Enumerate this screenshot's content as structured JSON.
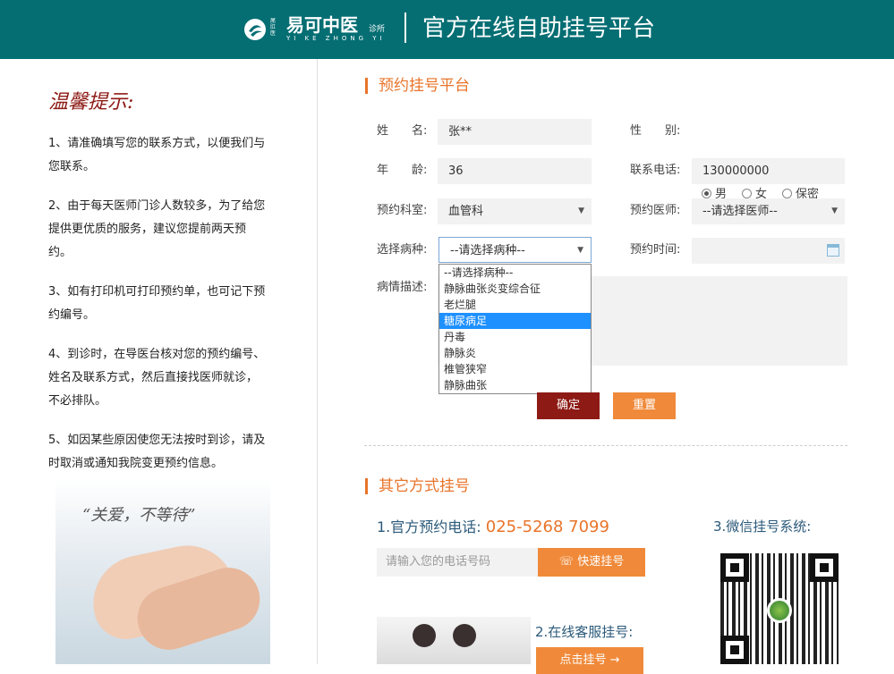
{
  "header": {
    "logo_small": "尾肛医",
    "logo_main": "易可中医",
    "logo_clinic": "诊所",
    "logo_pinyin": "YI KE ZHONG YI",
    "title": "官方在线自助挂号平台"
  },
  "tips": {
    "title": "温馨提示:",
    "items": [
      "1、请准确填写您的联系方式，以便我们与您联系。",
      "2、由于每天医师门诊人数较多，为了给您提供更优质的服务，建议您提前两天预约。",
      "3、如有打印机可打印预约单，也可记下预约编号。",
      "4、到诊时，在导医台核对您的预约编号、姓名及联系方式，然后直接找医师就诊，不必排队。",
      "5、如因某些原因使您无法按时到诊，请及时取消或通知我院变更预约信息。"
    ],
    "photo_quote": "“关爱，不等待”"
  },
  "form": {
    "section_title": "预约挂号平台",
    "name_label": "姓　　名:",
    "name_value": "张**",
    "gender_label": "性　　别:",
    "gender_options": [
      "男",
      "女",
      "保密"
    ],
    "gender_selected": "男",
    "age_label": "年　　龄:",
    "age_value": "36",
    "phone_label": "联系电话:",
    "phone_value": "130000000",
    "dept_label": "预约科室:",
    "dept_value": "血管科",
    "doctor_label": "预约医师:",
    "doctor_value": "--请选择医师--",
    "disease_label": "选择病种:",
    "disease_value": "--请选择病种--",
    "time_label": "预约时间:",
    "desc_label": "病情描述:",
    "disease_options": [
      "--请选择病种--",
      "静脉曲张炎变综合征",
      "老烂腿",
      "糖尿病足",
      "丹毒",
      "静脉炎",
      "椎管狭窄",
      "静脉曲张"
    ],
    "disease_highlighted": "糖尿病足",
    "confirm_label": "确定",
    "reset_label": "重置"
  },
  "other": {
    "section_title": "其它方式挂号",
    "phone_prefix": "1.官方预约电话:",
    "phone_number": "025-5268 7099",
    "wechat_label": "3.微信挂号系统:",
    "phone_input_placeholder": "请输入您的电话号码",
    "quick_button": "快速挂号",
    "service_label": "2.在线客服挂号:",
    "service_button": "点击挂号 →"
  },
  "colors": {
    "header_bg": "#046e73",
    "accent_orange": "#e8742a",
    "confirm_red": "#8d1a15",
    "dropdown_highlight": "#1e90ff"
  }
}
